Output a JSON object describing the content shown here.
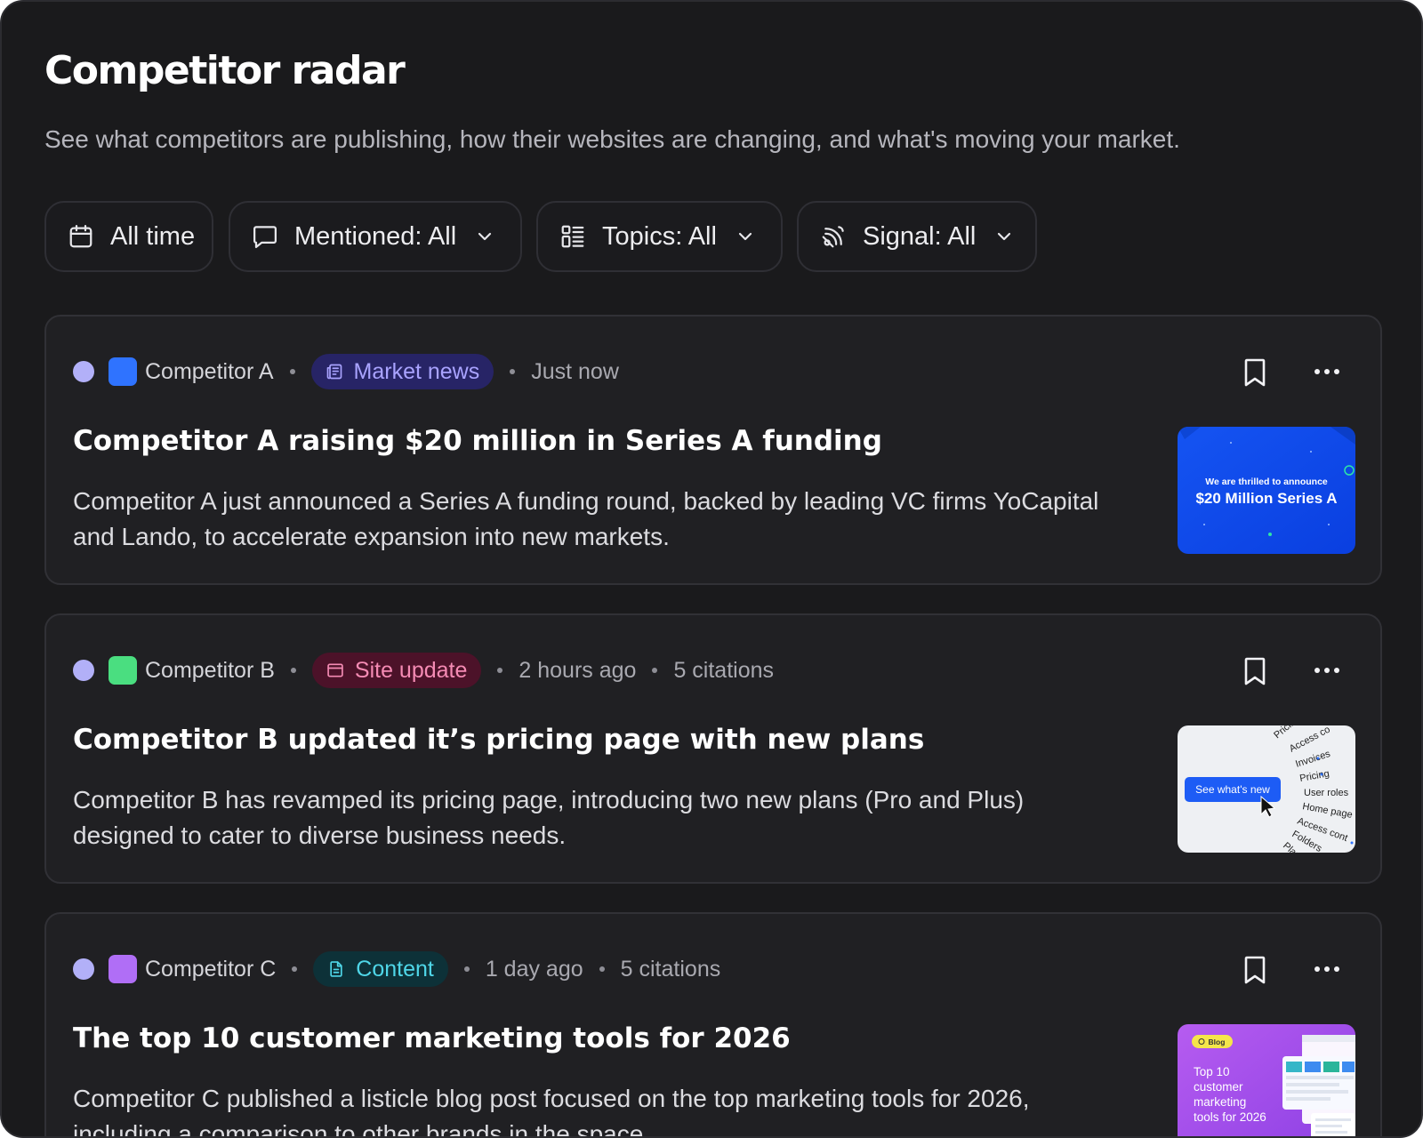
{
  "page": {
    "title": "Competitor radar",
    "subtitle": "See what competitors are publishing, how their websites are changing, and what's moving your market."
  },
  "filters": {
    "time": {
      "label": "All time",
      "icon": "calendar-icon"
    },
    "mentioned": {
      "label": "Mentioned: All",
      "icon": "chat-bubble-icon"
    },
    "topics": {
      "label": "Topics: All",
      "icon": "list-icon"
    },
    "signal": {
      "label": "Signal: All",
      "icon": "signal-icon"
    }
  },
  "colors": {
    "status_dot": "#b2b0f8",
    "competitor_a_logo": "#2f73ff",
    "competitor_b_logo": "#4ade80",
    "competitor_c_logo": "#b06ef6",
    "tag_market_news_bg": "#272466",
    "tag_market_news_fg": "#a9a3ff",
    "tag_site_update_bg": "#4c1229",
    "tag_site_update_fg": "#f58bb4",
    "tag_content_bg": "#0d3138",
    "tag_content_fg": "#4fd6e8"
  },
  "feed": [
    {
      "competitor": "Competitor A",
      "tag": "Market news",
      "time": "Just now",
      "citations": "",
      "title": "Competitor A raising $20 million in Series A funding",
      "description": "Competitor A just announced a Series A funding round, backed by leading VC firms YoCapital and Lando, to accelerate expansion into new markets.",
      "thumbnail": {
        "line1": "We are thrilled to announce",
        "line2": "$20 Million Series A"
      }
    },
    {
      "competitor": "Competitor B",
      "tag": "Site update",
      "time": "2 hours ago",
      "citations": "5 citations",
      "title": "Competitor B updated it’s pricing page with new plans",
      "description": "Competitor B has revamped its pricing page, introducing two new plans (Pro and Plus) designed to cater to diverse business needs.",
      "thumbnail": {
        "button": "See what's new",
        "words": [
          "Pricing",
          "Access co",
          "Invoices",
          "Pricing",
          "User roles",
          "Home page",
          "Access cont",
          "Folders",
          "Plan"
        ]
      }
    },
    {
      "competitor": "Competitor C",
      "tag": "Content",
      "time": "1 day ago",
      "citations": "5 citations",
      "title": "The top 10 customer marketing tools for 2026",
      "description": "Competitor C published a listicle blog post focused on the top marketing tools for 2026, including a comparison to other brands in the space.",
      "thumbnail": {
        "badge": "Blog",
        "line1": "Top 10",
        "line2": "customer",
        "line3": "marketing",
        "line4": "tools for 2026"
      }
    }
  ]
}
